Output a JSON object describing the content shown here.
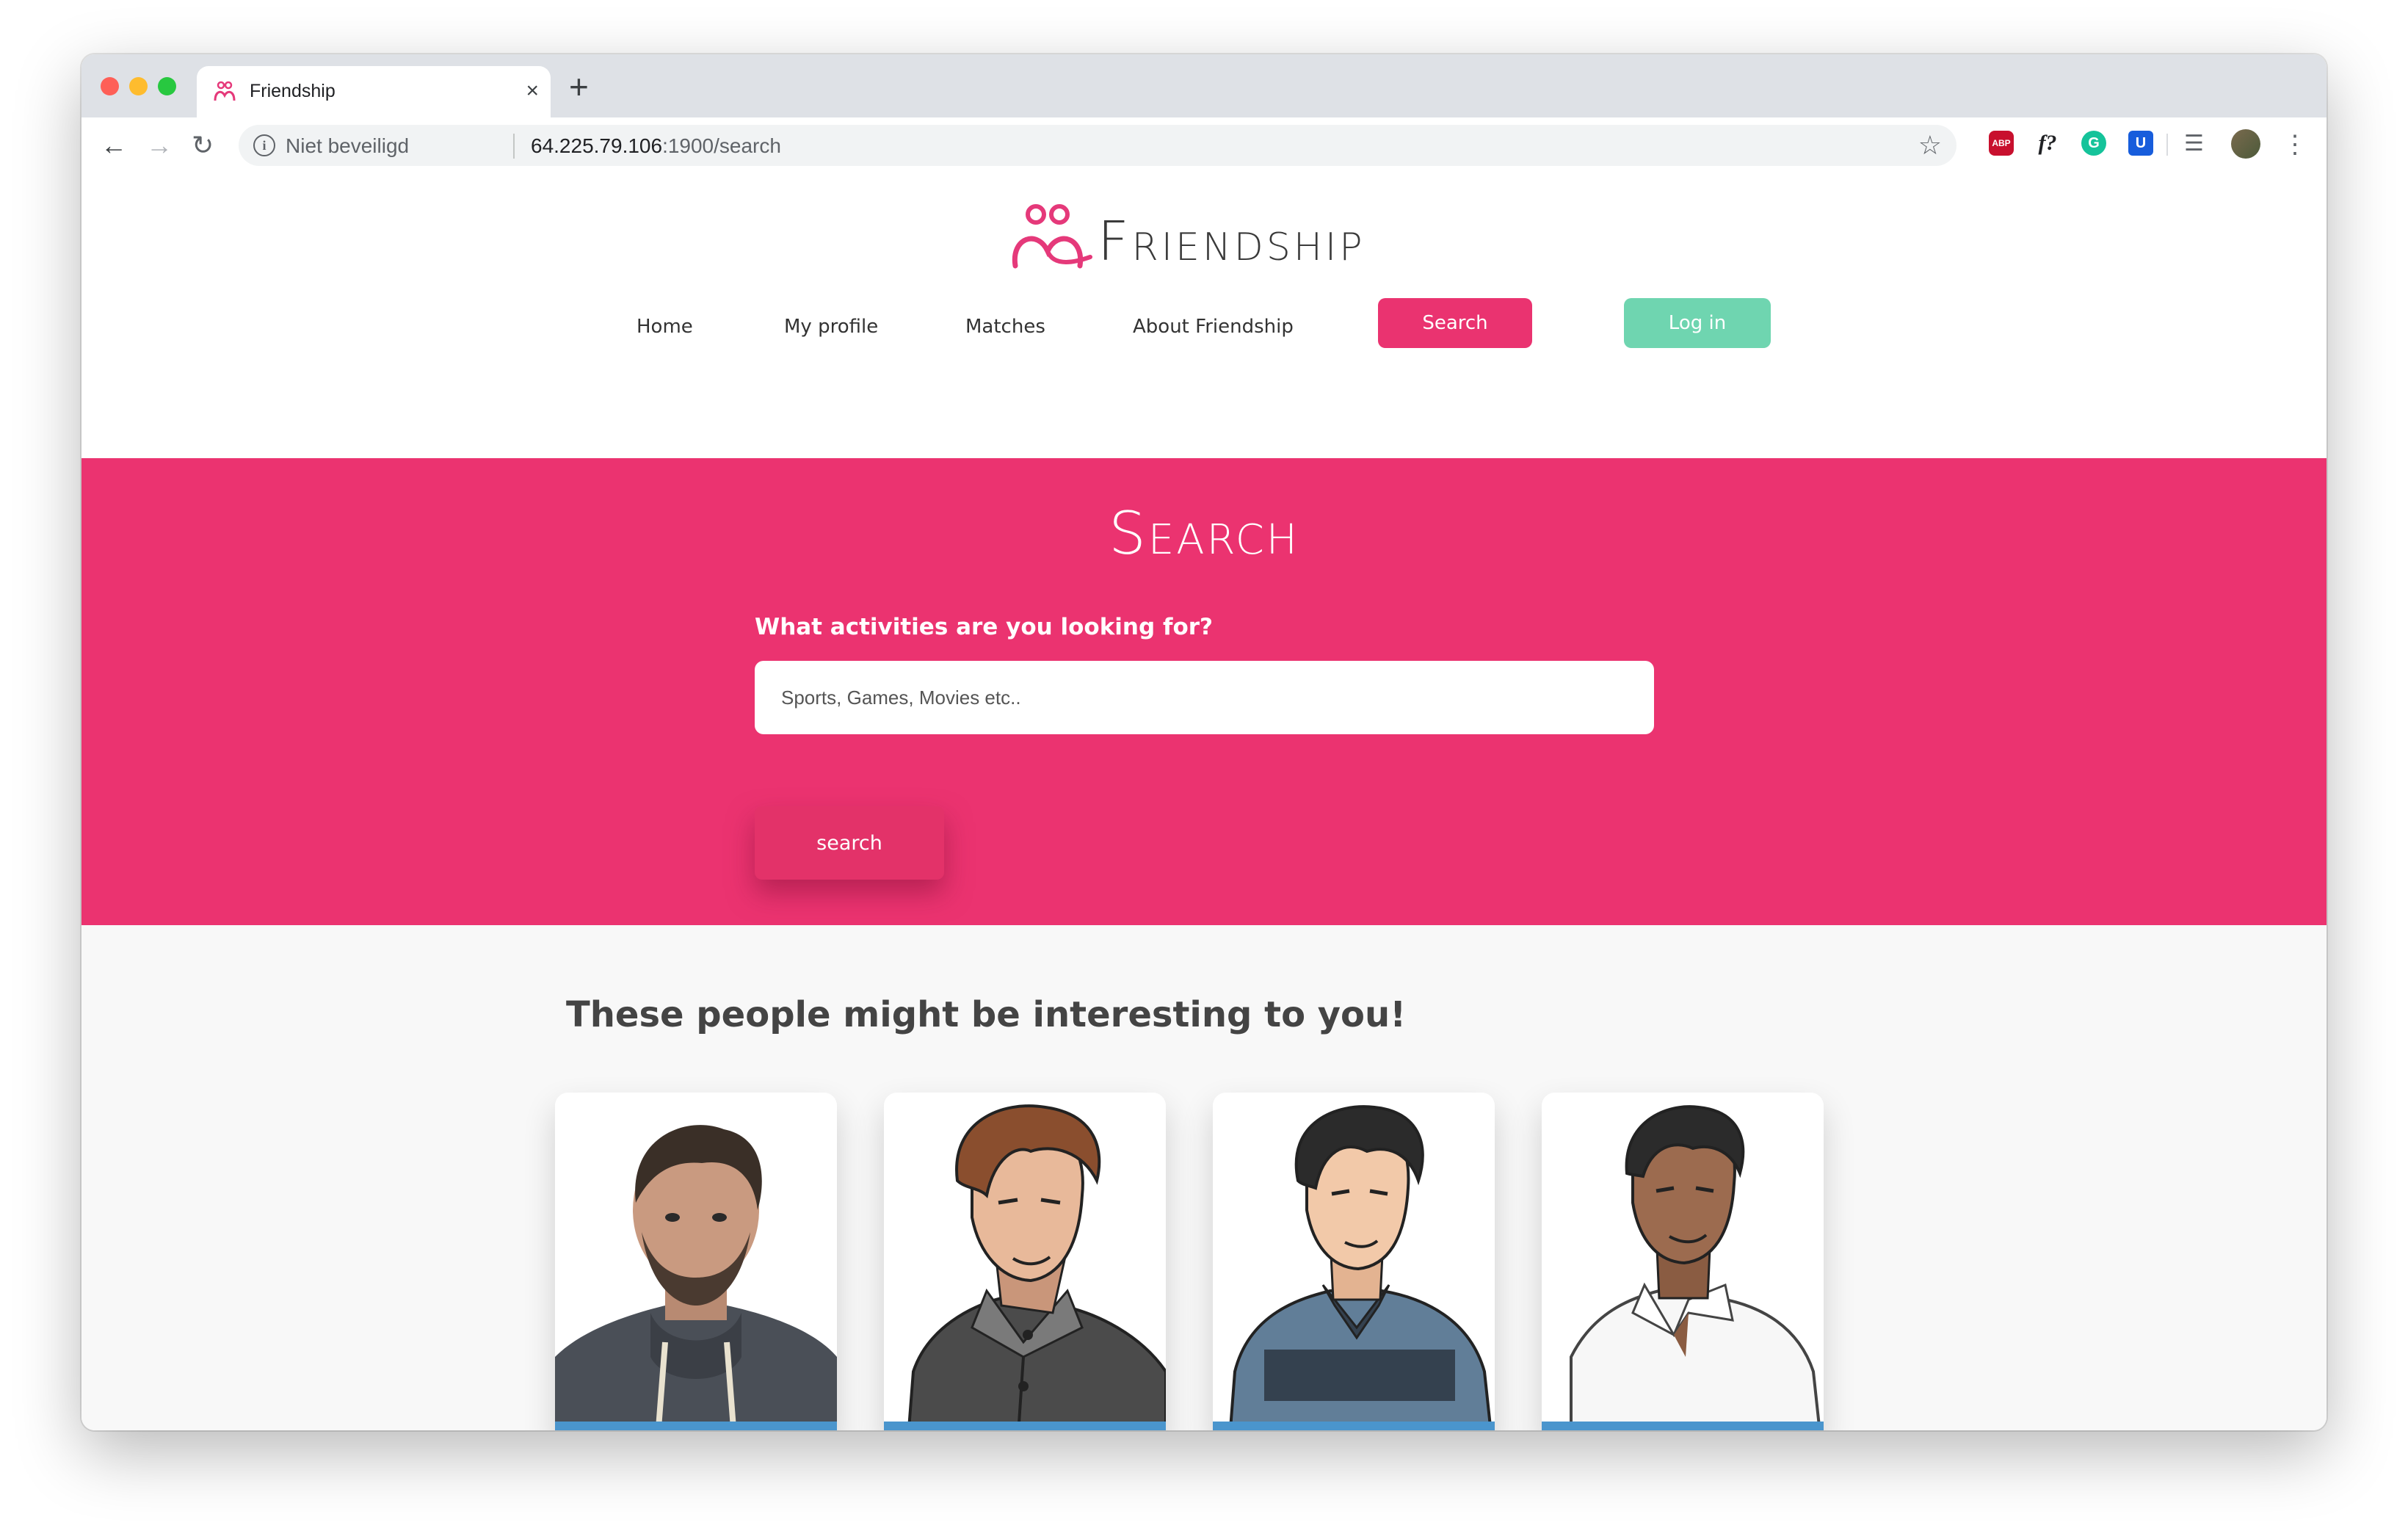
{
  "browser": {
    "tab_title": "Friendship",
    "new_tab_symbol": "+",
    "close_symbol": "×",
    "security_label": "Niet beveiligd",
    "url_host": "64.225.79.106",
    "url_rest": ":1900/search",
    "extensions": {
      "abp": "ABP",
      "fquery": "f?",
      "grammarly": "G",
      "bitwarden": "U"
    }
  },
  "site": {
    "logo_text": "Friendship",
    "nav": {
      "home": "Home",
      "profile": "My profile",
      "matches": "Matches",
      "about": "About Friendship",
      "search": "Search",
      "login": "Log in"
    },
    "colors": {
      "brand_pink": "#eb3370",
      "login_green": "#6fd5b0",
      "card_strip_blue": "#4a95cd"
    }
  },
  "hero": {
    "title": "Search",
    "question": "What activities are you looking for?",
    "input_placeholder": "Sports, Games, Movies etc..",
    "input_value": "",
    "button_label": "search"
  },
  "people": {
    "heading": "These people might be interesting to you!",
    "cards": [
      {
        "kind": "photo",
        "icon": "person-photo"
      },
      {
        "kind": "illustration",
        "icon": "person-illustration-brown-hair"
      },
      {
        "kind": "illustration",
        "icon": "person-illustration-blue-sweater"
      },
      {
        "kind": "illustration",
        "icon": "person-illustration-white-shirt"
      }
    ]
  }
}
